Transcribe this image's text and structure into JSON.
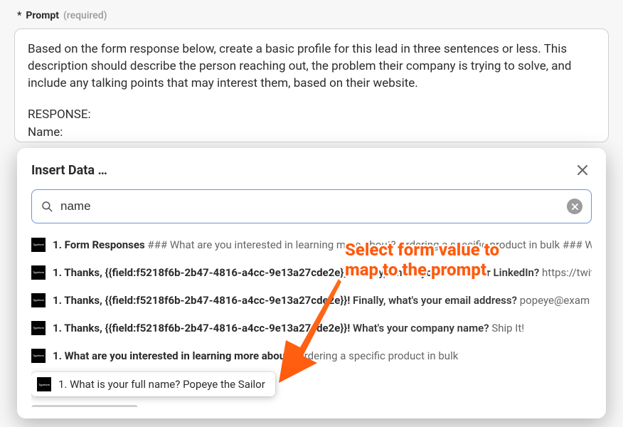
{
  "header": {
    "star": "*",
    "label": "Prompt",
    "required": "(required)"
  },
  "prompt": {
    "body": "Based on the form response below, create a basic profile for this lead in three sentences or less. This description should describe the person reaching out, the problem their company is trying to solve, and include any talking points that may interest them, based on their website.",
    "section": "RESPONSE:",
    "field1": "Name:"
  },
  "modal": {
    "title": "Insert Data …",
    "search_value": "name",
    "results": [
      {
        "lead": "1. Form Responses",
        "hash_prefix": "###",
        "body": "What are you interested in learning more about? Ordering a specific product in bulk",
        "hash_suffix": "### W",
        "after": ""
      },
      {
        "lead": "1. Thanks, {{field:f5218f6b-2b47-4816-a4cc-9e13a27cde2e}}!",
        "body": "Finally, what's your Twitter or LinkedIn?",
        "after": "https://twitter.c"
      },
      {
        "lead": "1. Thanks, {{field:f5218f6b-2b47-4816-a4cc-9e13a27cde2e}}!",
        "body": "Finally, what's your email address?",
        "after": "popeye@exam"
      },
      {
        "lead": "1. Thanks, {{field:f5218f6b-2b47-4816-a4cc-9e13a27cde2e}}!",
        "body": "What's your company name?",
        "after": "Ship It!"
      },
      {
        "lead": "1. What are you interested in learning more about?",
        "body": "",
        "after": "Ordering a specific product in bulk"
      }
    ],
    "highlight": {
      "lead": "1. What is your full name?",
      "after": "Popeye the Sailor"
    }
  },
  "annotation": {
    "line1": "Select form value to",
    "line2": "map to the prompt"
  },
  "icons": {
    "typeform": "Typeform"
  }
}
